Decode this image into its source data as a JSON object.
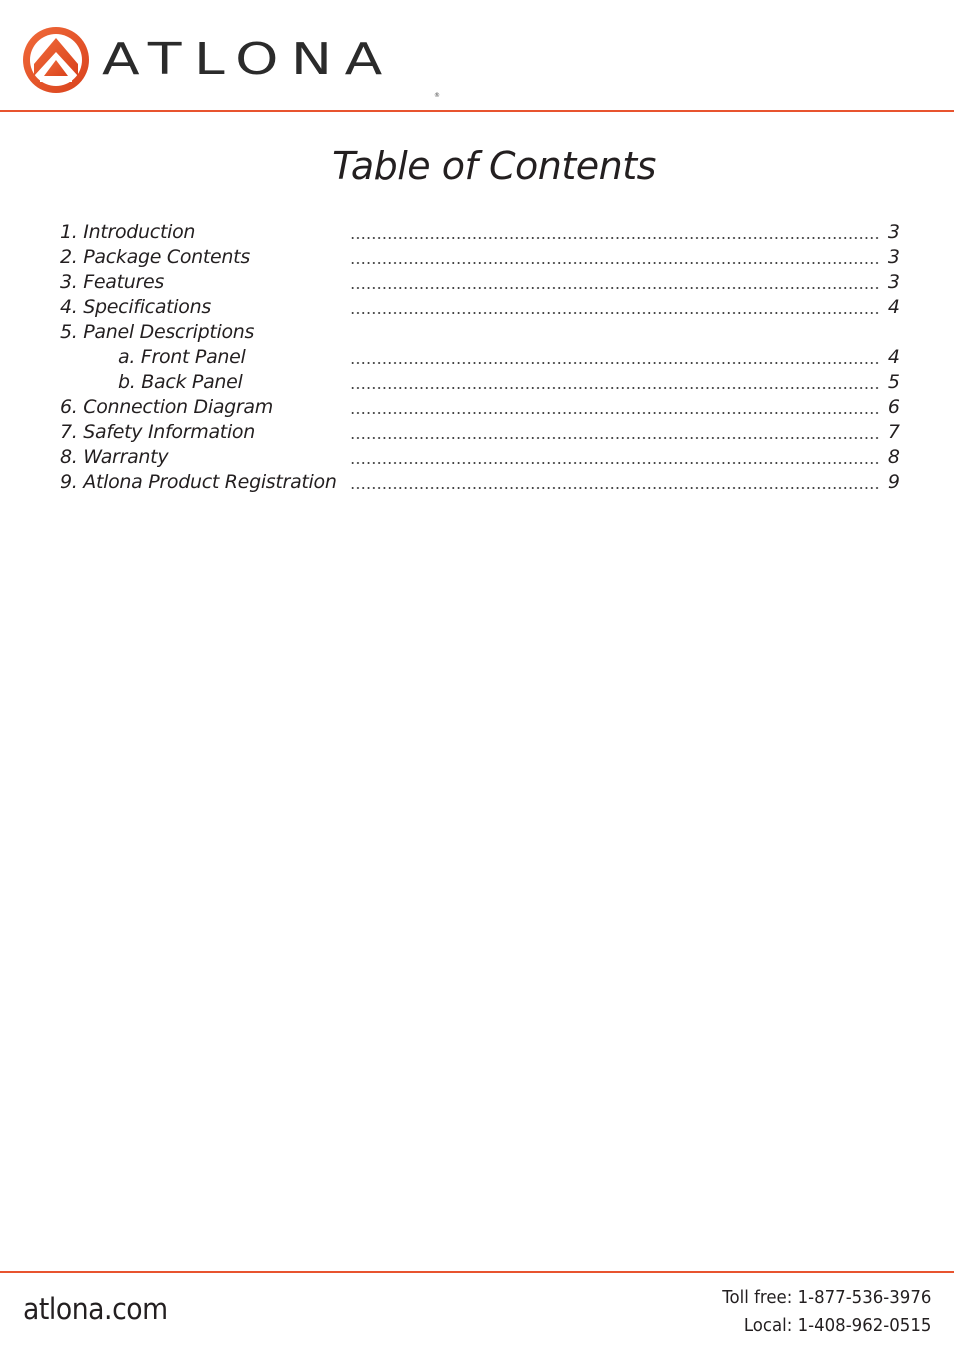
{
  "brand": {
    "logo_icon": "atlona-circle-chevron-icon",
    "wordmark": "ATLONA",
    "registered_mark": "®",
    "accent_color": "#e8542f"
  },
  "page": {
    "title": "Table of Contents"
  },
  "toc": [
    {
      "label": "1. Introduction",
      "page": "3",
      "indent": false
    },
    {
      "label": "2. Package Contents",
      "page": "3",
      "indent": false
    },
    {
      "label": "3. Features",
      "page": "3",
      "indent": false
    },
    {
      "label": "4. Specifications",
      "page": "4",
      "indent": false
    },
    {
      "label": "5. Panel Descriptions",
      "page": "",
      "indent": false
    },
    {
      "label": "a. Front Panel",
      "page": "4",
      "indent": true
    },
    {
      "label": "b. Back Panel",
      "page": "5",
      "indent": true
    },
    {
      "label": "6. Connection Diagram",
      "page": "6",
      "indent": false
    },
    {
      "label": "7. Safety Information",
      "page": "7",
      "indent": false
    },
    {
      "label": "8. Warranty",
      "page": "8",
      "indent": false
    },
    {
      "label": "9. Atlona Product Registration",
      "page": "9",
      "indent": false
    }
  ],
  "footer": {
    "website": "atlona.com",
    "toll_free": "Toll free: 1-877-536-3976",
    "local": "Local: 1-408-962-0515"
  }
}
